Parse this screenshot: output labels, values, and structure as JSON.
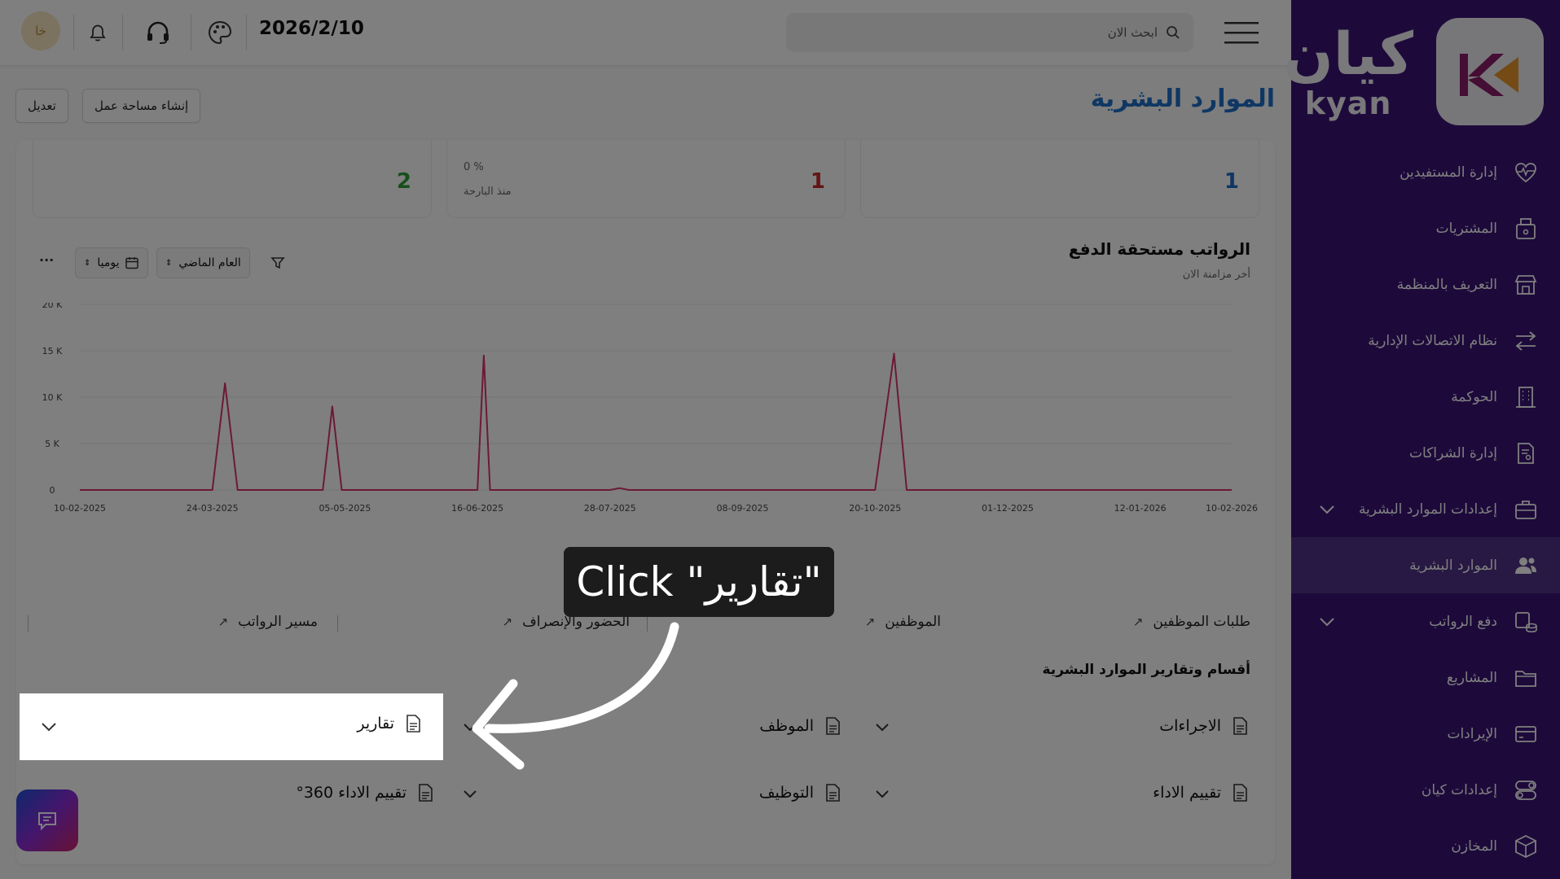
{
  "brand": {
    "name_ar": "كيان",
    "name_en": "kyan",
    "colors": {
      "sidebar": "#3a1477",
      "accent": "#1f6fc7",
      "chart_line": "#d9336e",
      "logo_k1": "#8a1d6b",
      "logo_k2": "#e8962b"
    }
  },
  "sidebar": {
    "items": [
      {
        "label": "إدارة المستفيدين",
        "icon": "heart-pulse-icon"
      },
      {
        "label": "المشتريات",
        "icon": "cash-register-icon"
      },
      {
        "label": "التعريف بالمنظمة",
        "icon": "store-icon"
      },
      {
        "label": "نظام الاتصالات الإدارية",
        "icon": "arrows-exchange-icon"
      },
      {
        "label": "الحوكمة",
        "icon": "building-icon"
      },
      {
        "label": "إدارة الشراكات",
        "icon": "document-user-icon"
      },
      {
        "label": "إعدادات الموارد البشرية",
        "icon": "briefcase-icon",
        "expandable": true
      },
      {
        "label": "الموارد البشرية",
        "icon": "users-icon",
        "active": true
      },
      {
        "label": "دفع الرواتب",
        "icon": "coins-icon",
        "expandable": true
      },
      {
        "label": "المشاريع",
        "icon": "folder-icon"
      },
      {
        "label": "الإيرادات",
        "icon": "credit-card-icon"
      },
      {
        "label": "إعدادات كيان",
        "icon": "toggles-icon"
      },
      {
        "label": "المخازن",
        "icon": "box-icon"
      }
    ]
  },
  "topbar": {
    "search_placeholder": "ابحث الان",
    "date": "2026/2/10",
    "avatar_initials": "خا"
  },
  "page": {
    "title": "الموارد البشرية",
    "create_workspace_label": "إنشاء مساحة عمل",
    "edit_label": "تعديل"
  },
  "stats": [
    {
      "value": "1",
      "color": "#1f6fc7"
    },
    {
      "value": "1",
      "color": "#c62828",
      "sub1": "% 0",
      "sub2": "منذ البارحة"
    },
    {
      "value": "2",
      "color": "#2e9e3a"
    }
  ],
  "chart_card": {
    "title": "الرواتب مستحقة الدفع",
    "subtitle": "أخر مزامنة الان",
    "period_label": "العام الماضي",
    "granularity_label": "يوميا",
    "more_label": "···"
  },
  "chart_data": {
    "type": "line",
    "x": [
      "10-02-2025",
      "24-03-2025",
      "05-05-2025",
      "16-06-2025",
      "28-07-2025",
      "08-09-2025",
      "20-10-2025",
      "01-12-2025",
      "12-01-2026",
      "10-02-2026"
    ],
    "yticks": [
      "0",
      "5 K",
      "10 K",
      "15 K",
      "20 K"
    ],
    "ylim": [
      0,
      20000
    ],
    "series": [
      {
        "points": [
          {
            "date": "10-02-2025",
            "value": 0
          },
          {
            "date": "24-03-2025",
            "value": 0
          },
          {
            "date": "28-03-2025",
            "value": 11500
          },
          {
            "date": "01-04-2025",
            "value": 0
          },
          {
            "date": "28-04-2025",
            "value": 0
          },
          {
            "date": "01-05-2025",
            "value": 9000
          },
          {
            "date": "04-05-2025",
            "value": 0
          },
          {
            "date": "16-06-2025",
            "value": 0
          },
          {
            "date": "18-06-2025",
            "value": 14500
          },
          {
            "date": "20-06-2025",
            "value": 0
          },
          {
            "date": "28-07-2025",
            "value": 0
          },
          {
            "date": "31-07-2025",
            "value": 200
          },
          {
            "date": "03-08-2025",
            "value": 0
          },
          {
            "date": "20-10-2025",
            "value": 0
          },
          {
            "date": "26-10-2025",
            "value": 14700
          },
          {
            "date": "30-10-2025",
            "value": 0
          },
          {
            "date": "10-02-2026",
            "value": 0
          }
        ]
      }
    ],
    "grid": true
  },
  "quick_links": [
    {
      "label": "طلبات الموظفين"
    },
    {
      "label": "الموظفين"
    },
    {
      "label": "الحضور والإنصراف"
    },
    {
      "label": "مسير الرواتب"
    }
  ],
  "sections": {
    "title": "أقسام وتقارير الموارد البشرية",
    "items": [
      {
        "label": "الاجراءات"
      },
      {
        "label": "الموظف"
      },
      {
        "label": "تقارير"
      },
      {
        "label": "تقييم الاداء"
      },
      {
        "label": "التوظيف"
      },
      {
        "label": "تقييم الاداء 360°"
      }
    ]
  },
  "tutorial": {
    "callout_text": "Click \"تقارير\""
  }
}
